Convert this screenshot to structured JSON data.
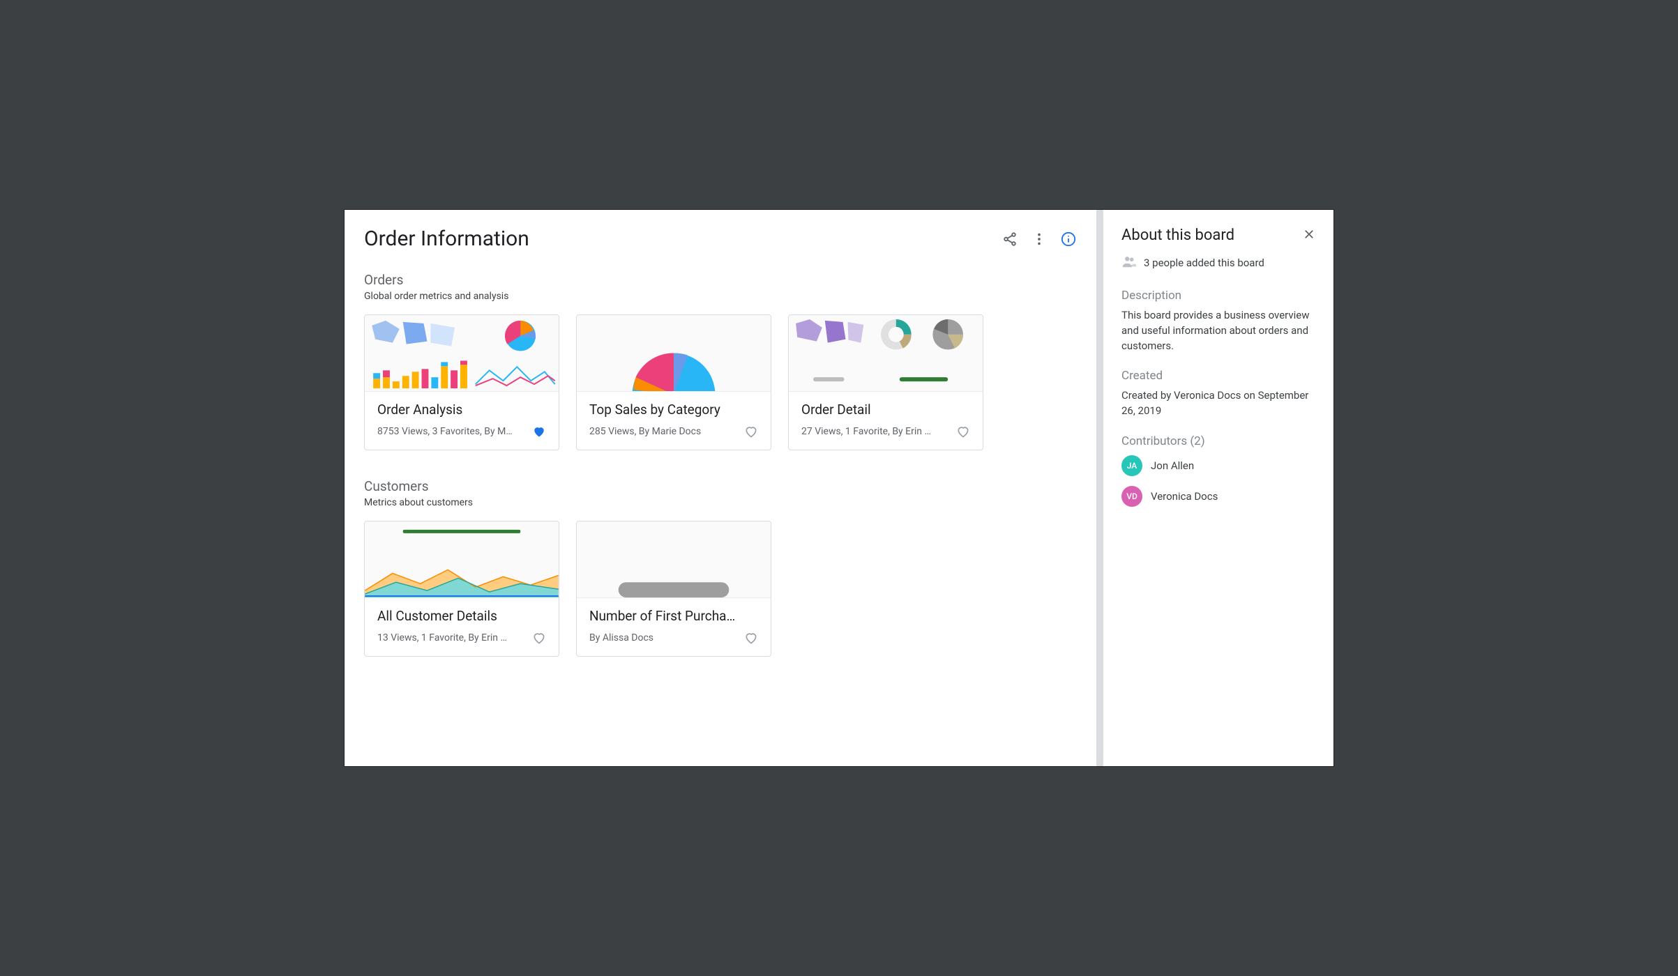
{
  "header": {
    "title": "Order Information"
  },
  "sections": [
    {
      "title": "Orders",
      "subtitle": "Global order metrics and analysis",
      "cards": [
        {
          "title": "Order Analysis",
          "meta": "8753 Views, 3 Favorites, By M…",
          "favorited": true
        },
        {
          "title": "Top Sales by Category",
          "meta": "285 Views, By Marie Docs",
          "favorited": false
        },
        {
          "title": "Order Detail",
          "meta": "27 Views, 1 Favorite, By Erin …",
          "favorited": false
        }
      ]
    },
    {
      "title": "Customers",
      "subtitle": "Metrics about customers",
      "cards": [
        {
          "title": "All Customer Details",
          "meta": "13 Views, 1 Favorite, By Erin …",
          "favorited": false
        },
        {
          "title": "Number of First Purcha…",
          "meta": "By Alissa Docs",
          "favorited": false
        }
      ]
    }
  ],
  "side": {
    "title": "About this board",
    "people_text": "3 people added this board",
    "description_label": "Description",
    "description_text": "This board provides a business overview and useful information about orders and customers.",
    "created_label": "Created",
    "created_text": "Created by Veronica Docs on September 26, 2019",
    "contributors_label": "Contributors (2)",
    "contributors": [
      {
        "initials": "JA",
        "name": "Jon Allen",
        "color": "teal"
      },
      {
        "initials": "VD",
        "name": "Veronica Docs",
        "color": "pink"
      }
    ]
  }
}
